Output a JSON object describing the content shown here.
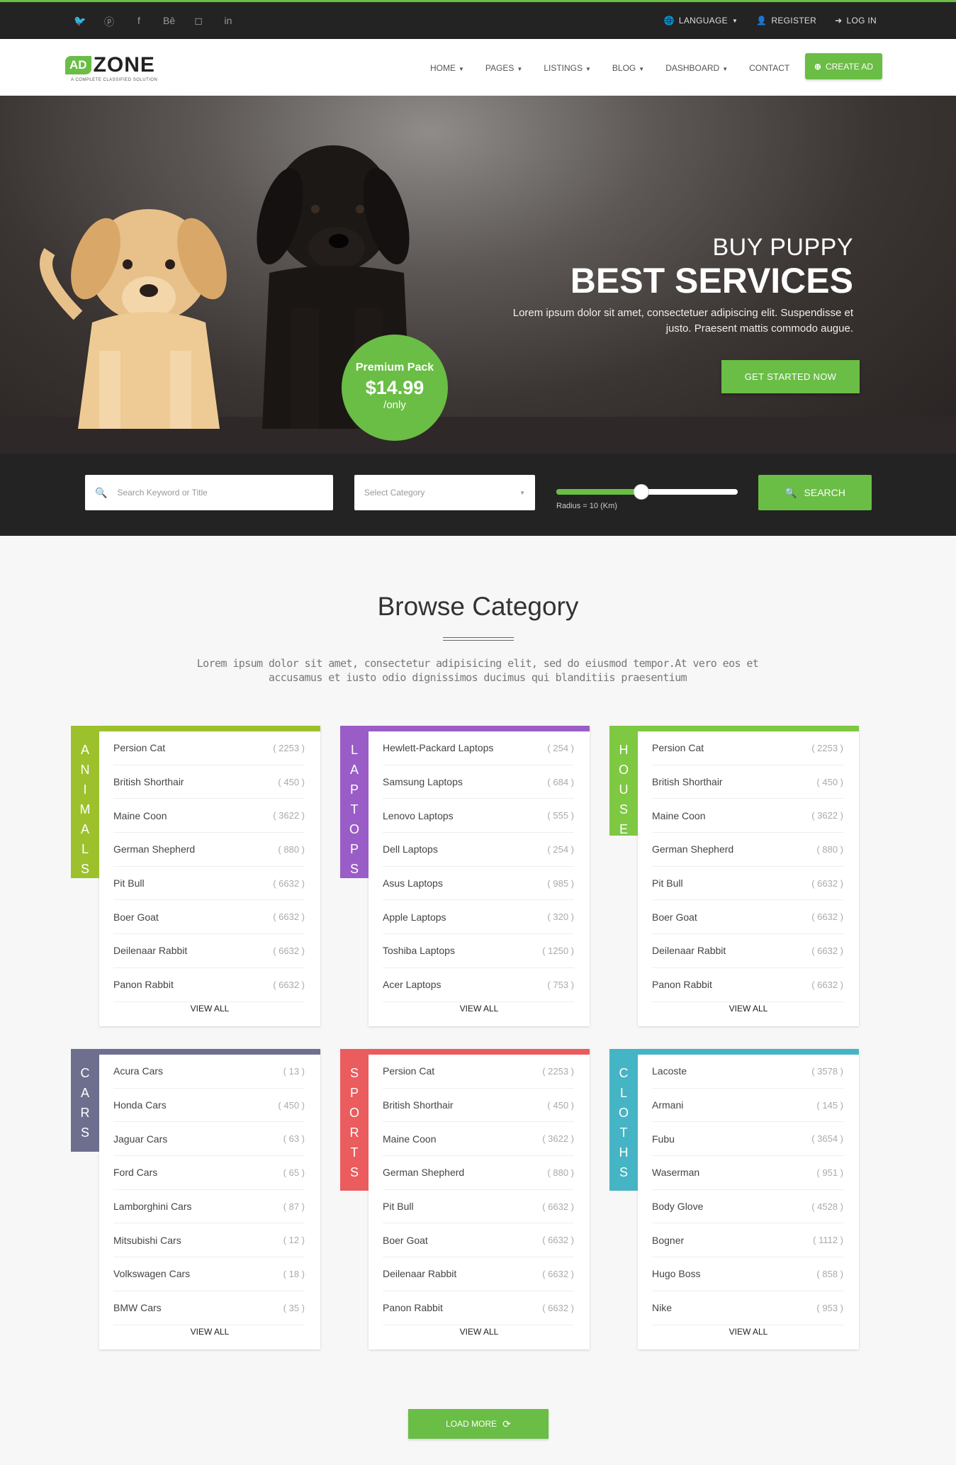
{
  "topbar": {
    "social": [
      "twitter-icon",
      "pinterest-icon",
      "facebook-icon",
      "behance-icon",
      "instagram-icon",
      "linkedin-icon"
    ],
    "social_glyphs": [
      "🐦",
      "ⓟ",
      "f",
      "Bē",
      "◻",
      "in"
    ],
    "language": "LANGUAGE",
    "register": "REGISTER",
    "login": "LOG IN"
  },
  "brand": {
    "ad": "AD",
    "zone": "ZONE",
    "tagline": "A COMPLETE CLASSIFIED SOLUTION",
    "accent": "#6abd45"
  },
  "nav": {
    "items": [
      "HOME",
      "PAGES",
      "LISTINGS",
      "BLOG",
      "DASHBOARD",
      "CONTACT"
    ],
    "create": "CREATE AD"
  },
  "hero": {
    "line1": "BUY PUPPY",
    "line2": "BEST SERVICES",
    "desc": "Lorem ipsum dolor sit amet, consectetuer adipiscing elit. Suspendisse et justo. Praesent mattis commodo augue.",
    "cta": "GET STARTED NOW",
    "badge_title": "Premium Pack",
    "badge_price": "$14.99",
    "badge_unit": "/only"
  },
  "search": {
    "keyword_placeholder": "Search Keyword or Title",
    "category_placeholder": "Select Category",
    "radius_label": "Radius = 10 (Km)",
    "radius_fraction": 0.47,
    "button": "SEARCH"
  },
  "browse": {
    "title": "Browse Category",
    "subtitle": "Lorem ipsum dolor sit amet, consectetur adipisicing elit, sed do eiusmod tempor.At vero eos et accusamus et iusto odio dignissimos ducimus qui blanditiis praesentium"
  },
  "view_all": "VIEW ALL",
  "load_more": "LOAD MORE",
  "categories": [
    {
      "name": "ANIMALS",
      "color": "#9dc12c",
      "items": [
        [
          "Persion Cat",
          "( 2253 )"
        ],
        [
          "British Shorthair",
          "( 450 )"
        ],
        [
          "Maine Coon",
          "( 3622 )"
        ],
        [
          "German Shepherd",
          "( 880 )"
        ],
        [
          "Pit Bull",
          "( 6632 )"
        ],
        [
          "Boer Goat",
          "( 6632 )"
        ],
        [
          "Deilenaar Rabbit",
          "( 6632 )"
        ],
        [
          "Panon Rabbit",
          "( 6632 )"
        ]
      ]
    },
    {
      "name": "LAPTOPS",
      "color": "#9a5cc6",
      "items": [
        [
          "Hewlett-Packard Laptops",
          "( 254 )"
        ],
        [
          "Samsung Laptops",
          "( 684 )"
        ],
        [
          "Lenovo Laptops",
          "( 555 )"
        ],
        [
          "Dell Laptops",
          "( 254 )"
        ],
        [
          "Asus Laptops",
          "( 985 )"
        ],
        [
          "Apple Laptops",
          "( 320 )"
        ],
        [
          "Toshiba Laptops",
          "( 1250 )"
        ],
        [
          "Acer Laptops",
          "( 753 )"
        ]
      ]
    },
    {
      "name": "HOUSE",
      "color": "#7ec842",
      "items": [
        [
          "Persion Cat",
          "( 2253 )"
        ],
        [
          "British Shorthair",
          "( 450 )"
        ],
        [
          "Maine Coon",
          "( 3622 )"
        ],
        [
          "German Shepherd",
          "( 880 )"
        ],
        [
          "Pit Bull",
          "( 6632 )"
        ],
        [
          "Boer Goat",
          "( 6632 )"
        ],
        [
          "Deilenaar Rabbit",
          "( 6632 )"
        ],
        [
          "Panon Rabbit",
          "( 6632 )"
        ]
      ]
    },
    {
      "name": "CARS",
      "color": "#6e6f8f",
      "items": [
        [
          "Acura Cars",
          "( 13 )"
        ],
        [
          "Honda Cars",
          "( 450 )"
        ],
        [
          "Jaguar Cars",
          "( 63 )"
        ],
        [
          "Ford Cars",
          "( 65 )"
        ],
        [
          "Lamborghini Cars",
          "( 87 )"
        ],
        [
          "Mitsubishi Cars",
          "( 12 )"
        ],
        [
          "Volkswagen Cars",
          "( 18 )"
        ],
        [
          "BMW Cars",
          "( 35 )"
        ]
      ]
    },
    {
      "name": "SPORTS",
      "color": "#ea5c5e",
      "items": [
        [
          "Persion Cat",
          "( 2253 )"
        ],
        [
          "British Shorthair",
          "( 450 )"
        ],
        [
          "Maine Coon",
          "( 3622 )"
        ],
        [
          "German Shepherd",
          "( 880 )"
        ],
        [
          "Pit Bull",
          "( 6632 )"
        ],
        [
          "Boer Goat",
          "( 6632 )"
        ],
        [
          "Deilenaar Rabbit",
          "( 6632 )"
        ],
        [
          "Panon Rabbit",
          "( 6632 )"
        ]
      ]
    },
    {
      "name": "CLOTHS",
      "color": "#45b4c5",
      "items": [
        [
          "Lacoste",
          "( 3578 )"
        ],
        [
          "Armani",
          "( 145 )"
        ],
        [
          "Fubu",
          "( 3654 )"
        ],
        [
          "Waserman",
          "( 951 )"
        ],
        [
          "Body Glove",
          "( 4528 )"
        ],
        [
          "Bogner",
          "( 1112 )"
        ],
        [
          "Hugo Boss",
          "( 858 )"
        ],
        [
          "Nike",
          "( 953 )"
        ]
      ]
    }
  ]
}
